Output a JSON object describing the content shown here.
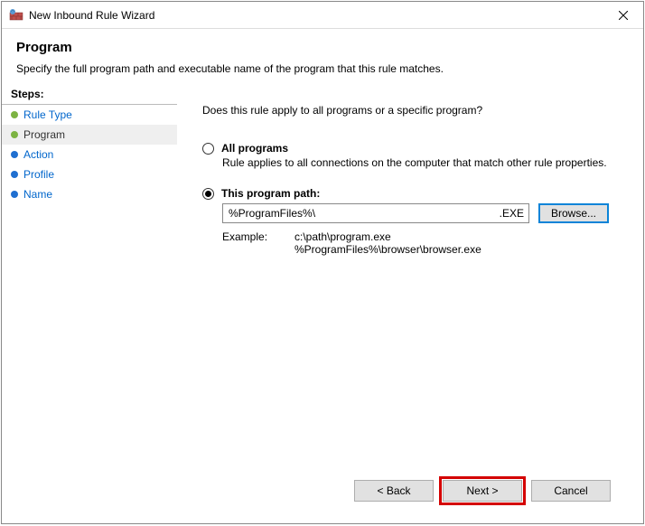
{
  "window": {
    "title": "New Inbound Rule Wizard"
  },
  "header": {
    "title": "Program",
    "subtitle": "Specify the full program path and executable name of the program that this rule matches."
  },
  "sidebar": {
    "heading": "Steps:",
    "items": [
      {
        "label": "Rule Type"
      },
      {
        "label": "Program"
      },
      {
        "label": "Action"
      },
      {
        "label": "Profile"
      },
      {
        "label": "Name"
      }
    ]
  },
  "content": {
    "question": "Does this rule apply to all programs or a specific program?",
    "option_all": {
      "label": "All programs",
      "desc": "Rule applies to all connections on the computer that match other rule properties."
    },
    "option_this": {
      "label": "This program path:",
      "value": "%ProgramFiles%\\",
      "ext": ".EXE",
      "browse": "Browse..."
    },
    "example": {
      "label": "Example:",
      "line1": "c:\\path\\program.exe",
      "line2": "%ProgramFiles%\\browser\\browser.exe"
    }
  },
  "footer": {
    "back": "< Back",
    "next": "Next >",
    "cancel": "Cancel"
  }
}
